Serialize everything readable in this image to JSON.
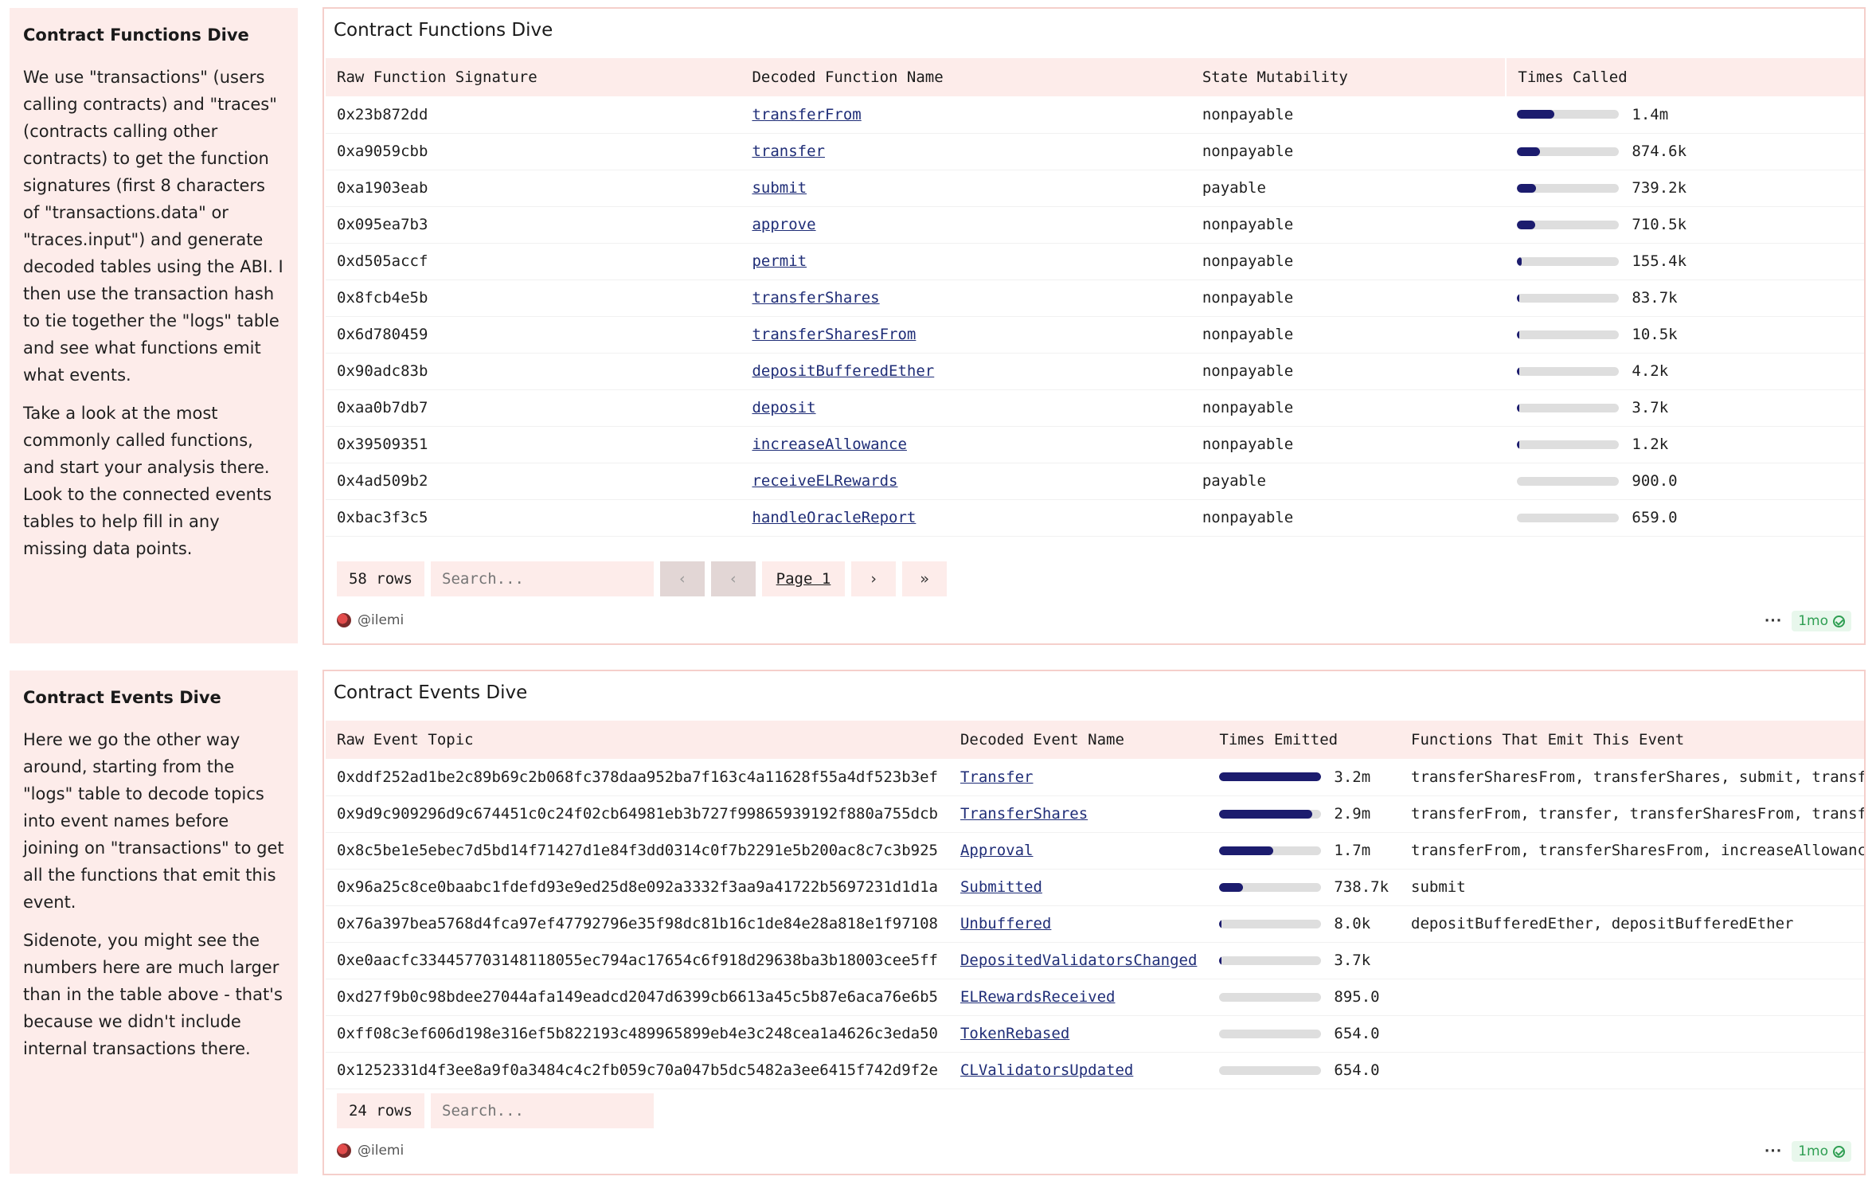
{
  "functions_note": {
    "title": "Contract Functions Dive",
    "p1": "We use \"transactions\" (users calling contracts) and \"traces\" (contracts calling other contracts) to get the function signatures (first 8 characters of \"transactions.data\" or \"traces.input\") and generate decoded tables using the ABI. I then use the transaction hash to tie together the \"logs\" table and see what functions emit what events.",
    "p2": "Take a look at the most commonly called functions, and start your analysis there. Look to the connected events tables to help fill in any missing data points."
  },
  "functions_table": {
    "title": "Contract Functions Dive",
    "columns": [
      "Raw Function Signature",
      "Decoded Function Name",
      "State Mutability",
      "Times Called"
    ],
    "rows": [
      {
        "sig": "0x23b872dd",
        "name": "transferFrom",
        "mut": "nonpayable",
        "called": "1.4m",
        "frac": 0.36
      },
      {
        "sig": "0xa9059cbb",
        "name": "transfer",
        "mut": "nonpayable",
        "called": "874.6k",
        "frac": 0.22
      },
      {
        "sig": "0xa1903eab",
        "name": "submit",
        "mut": "payable",
        "called": "739.2k",
        "frac": 0.185
      },
      {
        "sig": "0x095ea7b3",
        "name": "approve",
        "mut": "nonpayable",
        "called": "710.5k",
        "frac": 0.178
      },
      {
        "sig": "0xd505accf",
        "name": "permit",
        "mut": "nonpayable",
        "called": "155.4k",
        "frac": 0.04
      },
      {
        "sig": "0x8fcb4e5b",
        "name": "transferShares",
        "mut": "nonpayable",
        "called": "83.7k",
        "frac": 0.021
      },
      {
        "sig": "0x6d780459",
        "name": "transferSharesFrom",
        "mut": "nonpayable",
        "called": "10.5k",
        "frac": 0.006
      },
      {
        "sig": "0x90adc83b",
        "name": "depositBufferedEther",
        "mut": "nonpayable",
        "called": "4.2k",
        "frac": 0.004
      },
      {
        "sig": "0xaa0b7db7",
        "name": "deposit",
        "mut": "nonpayable",
        "called": "3.7k",
        "frac": 0.004
      },
      {
        "sig": "0x39509351",
        "name": "increaseAllowance",
        "mut": "nonpayable",
        "called": "1.2k",
        "frac": 0.002
      },
      {
        "sig": "0x4ad509b2",
        "name": "receiveELRewards",
        "mut": "payable",
        "called": "900.0",
        "frac": 0.0
      },
      {
        "sig": "0xbac3f3c5",
        "name": "handleOracleReport",
        "mut": "nonpayable",
        "called": "659.0",
        "frac": 0.0
      }
    ],
    "rows_count": "58 rows",
    "search_placeholder": "Search...",
    "page_label": "Page 1",
    "author": "@ilemi",
    "age": "1mo"
  },
  "events_note": {
    "title": "Contract Events Dive",
    "p1": "Here we go the other way around, starting from the \"logs\" table to decode topics into event names before joining on \"transactions\" to get all the functions that emit this event.",
    "p2": "Sidenote, you might see the numbers here are much larger than in the table above - that's because we didn't include internal transactions there."
  },
  "events_table": {
    "title": "Contract Events Dive",
    "columns": [
      "Raw Event Topic",
      "Decoded Event Name",
      "Times Emitted",
      "Functions That Emit This Event"
    ],
    "rows": [
      {
        "topic": "0xddf252ad1be2c89b69c2b068fc378daa952ba7f163c4a11628f55a4df523b3ef",
        "name": "Transfer",
        "emitted": "3.2m",
        "frac": 1.0,
        "fns": "transferSharesFrom, transferShares, submit, transferFrom, transfer"
      },
      {
        "topic": "0x9d9c909296d9c674451c0c24f02cb64981eb3b727f99865939192f880a755dcb",
        "name": "TransferShares",
        "emitted": "2.9m",
        "frac": 0.91,
        "fns": "transferFrom, transfer, transferSharesFrom, transferShares"
      },
      {
        "topic": "0x8c5be1e5ebec7d5bd14f71427d1e84f3dd0314c0f7b2291e5b200ac8c7c3b925",
        "name": "Approval",
        "emitted": "1.7m",
        "frac": 0.53,
        "fns": "transferFrom, transferSharesFrom, increaseAllowance"
      },
      {
        "topic": "0x96a25c8ce0baabc1fdefd93e9ed25d8e092a3332f3aa9a41722b5697231d1d1a",
        "name": "Submitted",
        "emitted": "738.7k",
        "frac": 0.23,
        "fns": "submit"
      },
      {
        "topic": "0x76a397bea5768d4fca97ef47792796e35f98dc81b16c1de84e28a818e1f97108",
        "name": "Unbuffered",
        "emitted": "8.0k",
        "frac": 0.01,
        "fns": "depositBufferedEther, depositBufferedEther"
      },
      {
        "topic": "0xe0aacfc334457703148118055ec794ac17654c6f918d29638ba3b18003cee5ff",
        "name": "DepositedValidatorsChanged",
        "emitted": "3.7k",
        "frac": 0.008,
        "fns": ""
      },
      {
        "topic": "0xd27f9b0c98bdee27044afa149eadcd2047d6399cb6613a45c5b87e6aca76e6b5",
        "name": "ELRewardsReceived",
        "emitted": "895.0",
        "frac": 0.0,
        "fns": ""
      },
      {
        "topic": "0xff08c3ef606d198e316ef5b822193c489965899eb4e3c248cea1a4626c3eda50",
        "name": "TokenRebased",
        "emitted": "654.0",
        "frac": 0.0,
        "fns": ""
      },
      {
        "topic": "0x1252331d4f3ee8a9f0a3484c4c2fb059c70a047b5dc5482a3ee6415f742d9f2e",
        "name": "CLValidatorsUpdated",
        "emitted": "654.0",
        "frac": 0.0,
        "fns": ""
      }
    ],
    "rows_count": "24 rows",
    "search_placeholder": "Search...",
    "author": "@ilemi",
    "age": "1mo"
  },
  "colors": {
    "accent_bg": "#fdecea",
    "bar": "#1c1c6e",
    "link": "#1f2d77",
    "ok": "#2e9e52"
  }
}
